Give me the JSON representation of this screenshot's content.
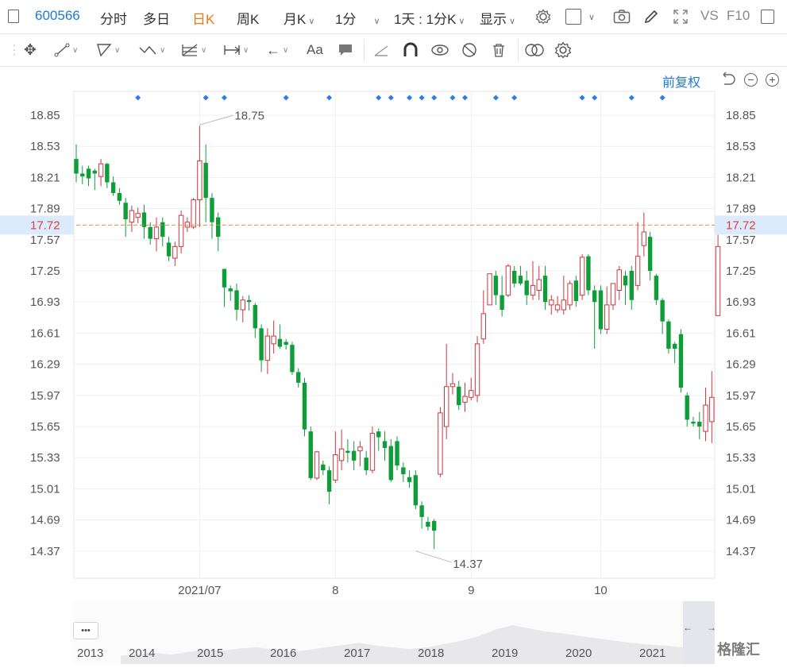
{
  "topbar": {
    "code": "600566",
    "tabs": [
      "分时",
      "多日",
      "日K",
      "周K",
      "月K",
      "1分"
    ],
    "active_tab": "日K",
    "range_label": "1天 : 1分K",
    "display_label": "显示",
    "vs_label": "VS",
    "f10_label": "F10"
  },
  "toolbar": {
    "text_tool": "Aa"
  },
  "chart_header": {
    "fuquan_label": "前复权"
  },
  "chart_data": {
    "type": "candlestick",
    "ylim": [
      14.2,
      19.05
    ],
    "y_ticks": [
      "18.85",
      "18.53",
      "18.21",
      "17.89",
      "17.57",
      "17.25",
      "16.93",
      "16.61",
      "16.29",
      "15.97",
      "15.65",
      "15.33",
      "15.01",
      "14.69",
      "14.37"
    ],
    "current_price": "17.72",
    "x_labels": [
      {
        "label": "2021/07",
        "index": 20
      },
      {
        "label": "8",
        "index": 42
      },
      {
        "label": "9",
        "index": 64
      },
      {
        "label": "10",
        "index": 85
      }
    ],
    "max_label": {
      "value": "18.75",
      "index": 20
    },
    "min_label": {
      "value": "14.37",
      "index": 55
    },
    "up_color": "#d0353f",
    "down_color": "#0f9d3a",
    "event_marker_indices": [
      10,
      21,
      24,
      34,
      41,
      49,
      51,
      54,
      56,
      58,
      61,
      63,
      68,
      71,
      82,
      84,
      90,
      95
    ],
    "candles": [
      [
        18.4,
        18.25,
        18.55,
        18.16
      ],
      [
        18.25,
        18.22,
        18.33,
        18.14
      ],
      [
        18.3,
        18.2,
        18.33,
        18.12
      ],
      [
        18.28,
        18.25,
        18.3,
        18.08
      ],
      [
        18.22,
        18.35,
        18.4,
        18.12
      ],
      [
        18.35,
        18.16,
        18.36,
        18.1
      ],
      [
        18.16,
        18.05,
        18.22,
        18.02
      ],
      [
        18.05,
        17.97,
        18.1,
        17.93
      ],
      [
        17.95,
        17.78,
        18.0,
        17.6
      ],
      [
        17.75,
        17.87,
        17.92,
        17.65
      ],
      [
        17.8,
        17.84,
        17.9,
        17.74
      ],
      [
        17.85,
        17.7,
        17.93,
        17.58
      ],
      [
        17.7,
        17.58,
        17.75,
        17.52
      ],
      [
        17.58,
        17.7,
        17.8,
        17.45
      ],
      [
        17.75,
        17.6,
        17.8,
        17.5
      ],
      [
        17.54,
        17.4,
        17.6,
        17.35
      ],
      [
        17.38,
        17.5,
        17.55,
        17.3
      ],
      [
        17.5,
        17.82,
        17.87,
        17.43
      ],
      [
        17.7,
        17.75,
        17.8,
        17.65
      ],
      [
        17.7,
        17.98,
        18.0,
        17.68
      ],
      [
        17.98,
        18.38,
        18.74,
        17.7
      ],
      [
        18.36,
        18.0,
        18.55,
        17.75
      ],
      [
        18.0,
        17.75,
        18.05,
        17.58
      ],
      [
        17.8,
        17.6,
        17.85,
        17.45
      ],
      [
        17.27,
        17.08,
        17.27,
        16.88
      ],
      [
        17.07,
        17.04,
        17.1,
        16.94
      ],
      [
        17.05,
        16.85,
        17.12,
        16.74
      ],
      [
        16.85,
        16.95,
        16.99,
        16.72
      ],
      [
        16.95,
        16.93,
        17.0,
        16.84
      ],
      [
        16.9,
        16.66,
        16.92,
        16.56
      ],
      [
        16.66,
        16.33,
        16.7,
        16.21
      ],
      [
        16.33,
        16.58,
        16.66,
        16.19
      ],
      [
        16.5,
        16.58,
        16.74,
        16.4
      ],
      [
        16.55,
        16.47,
        16.7,
        16.45
      ],
      [
        16.52,
        16.49,
        16.55,
        16.44
      ],
      [
        16.49,
        16.21,
        16.52,
        16.18
      ],
      [
        16.21,
        16.1,
        16.25,
        16.05
      ],
      [
        16.1,
        15.62,
        16.15,
        15.55
      ],
      [
        15.6,
        15.12,
        15.65,
        15.1
      ],
      [
        15.12,
        15.39,
        15.4,
        15.1
      ],
      [
        15.26,
        15.2,
        15.3,
        15.15
      ],
      [
        15.2,
        14.98,
        15.24,
        14.85
      ],
      [
        15.1,
        15.36,
        15.6,
        15.07
      ],
      [
        15.3,
        15.42,
        15.62,
        15.2
      ],
      [
        15.4,
        15.38,
        15.52,
        15.28
      ],
      [
        15.4,
        15.3,
        15.5,
        15.2
      ],
      [
        15.4,
        15.44,
        15.5,
        15.24
      ],
      [
        15.33,
        15.2,
        15.4,
        15.15
      ],
      [
        15.2,
        15.58,
        15.65,
        15.17
      ],
      [
        15.6,
        15.54,
        15.63,
        15.4
      ],
      [
        15.5,
        15.43,
        15.6,
        15.3
      ],
      [
        15.45,
        15.1,
        15.52,
        15.08
      ],
      [
        15.5,
        15.25,
        15.55,
        15.2
      ],
      [
        15.23,
        15.16,
        15.28,
        15.08
      ],
      [
        15.13,
        15.08,
        15.2,
        15.02
      ],
      [
        15.15,
        14.84,
        15.2,
        14.8
      ],
      [
        14.84,
        14.72,
        14.88,
        14.6
      ],
      [
        14.67,
        14.62,
        14.72,
        14.58
      ],
      [
        14.68,
        14.58,
        14.7,
        14.39
      ],
      [
        15.16,
        15.79,
        15.85,
        15.13
      ],
      [
        15.65,
        16.06,
        16.5,
        15.52
      ],
      [
        16.06,
        16.09,
        16.2,
        15.98
      ],
      [
        16.06,
        15.87,
        16.12,
        15.82
      ],
      [
        15.9,
        15.96,
        16.1,
        15.8
      ],
      [
        15.95,
        16.02,
        16.15,
        15.92
      ],
      [
        15.97,
        16.5,
        16.58,
        15.9
      ],
      [
        16.55,
        16.81,
        17.05,
        16.5
      ],
      [
        16.9,
        17.22,
        17.05,
        16.95
      ],
      [
        17.2,
        17.0,
        17.25,
        16.9
      ],
      [
        17.0,
        16.85,
        17.2,
        16.78
      ],
      [
        17.0,
        17.3,
        17.32,
        16.98
      ],
      [
        17.25,
        17.12,
        17.3,
        17.08
      ],
      [
        17.2,
        17.12,
        17.3,
        17.1
      ],
      [
        17.15,
        17.0,
        17.25,
        16.9
      ],
      [
        17.0,
        17.1,
        17.35,
        16.95
      ],
      [
        17.05,
        17.16,
        17.3,
        16.95
      ],
      [
        17.2,
        16.93,
        17.3,
        16.85
      ],
      [
        16.9,
        16.95,
        17.0,
        16.8
      ],
      [
        16.85,
        16.9,
        16.99,
        16.82
      ],
      [
        16.85,
        16.95,
        17.2,
        16.8
      ],
      [
        16.9,
        17.12,
        17.15,
        16.85
      ],
      [
        17.15,
        16.94,
        17.2,
        16.88
      ],
      [
        17.0,
        17.39,
        17.42,
        16.95
      ],
      [
        17.4,
        17.05,
        17.42,
        17.0
      ],
      [
        17.05,
        16.93,
        17.1,
        16.45
      ],
      [
        17.05,
        16.65,
        17.1,
        16.6
      ],
      [
        16.65,
        16.9,
        17.09,
        16.6
      ],
      [
        16.9,
        17.12,
        17.12,
        16.85
      ],
      [
        17.05,
        17.26,
        17.3,
        16.95
      ],
      [
        17.2,
        17.1,
        17.25,
        16.9
      ],
      [
        17.25,
        16.95,
        17.3,
        16.85
      ],
      [
        17.1,
        17.4,
        17.75,
        17.05
      ],
      [
        17.51,
        17.65,
        17.85,
        17.4
      ],
      [
        17.6,
        17.25,
        17.65,
        17.15
      ],
      [
        17.2,
        16.95,
        17.22,
        16.9
      ],
      [
        16.95,
        16.73,
        16.97,
        16.6
      ],
      [
        16.73,
        16.45,
        16.75,
        16.4
      ],
      [
        16.5,
        16.45,
        16.52,
        16.3
      ],
      [
        16.6,
        16.05,
        16.65,
        16.0
      ],
      [
        15.97,
        15.72,
        16.0,
        15.65
      ],
      [
        15.7,
        15.68,
        15.75,
        15.65
      ],
      [
        15.7,
        15.65,
        15.8,
        15.52
      ],
      [
        15.6,
        15.87,
        16.05,
        15.5
      ],
      [
        15.7,
        15.95,
        16.22,
        15.48
      ],
      [
        16.79,
        17.5,
        17.62,
        16.79
      ]
    ]
  },
  "navigator": {
    "year_labels": [
      "2013",
      "2014",
      "2015",
      "2016",
      "2017",
      "2018",
      "2019",
      "2020",
      "2021"
    ],
    "more_label": "•••",
    "left_arrow": "←",
    "right_arrow": "→"
  },
  "watermark": "格隆汇"
}
